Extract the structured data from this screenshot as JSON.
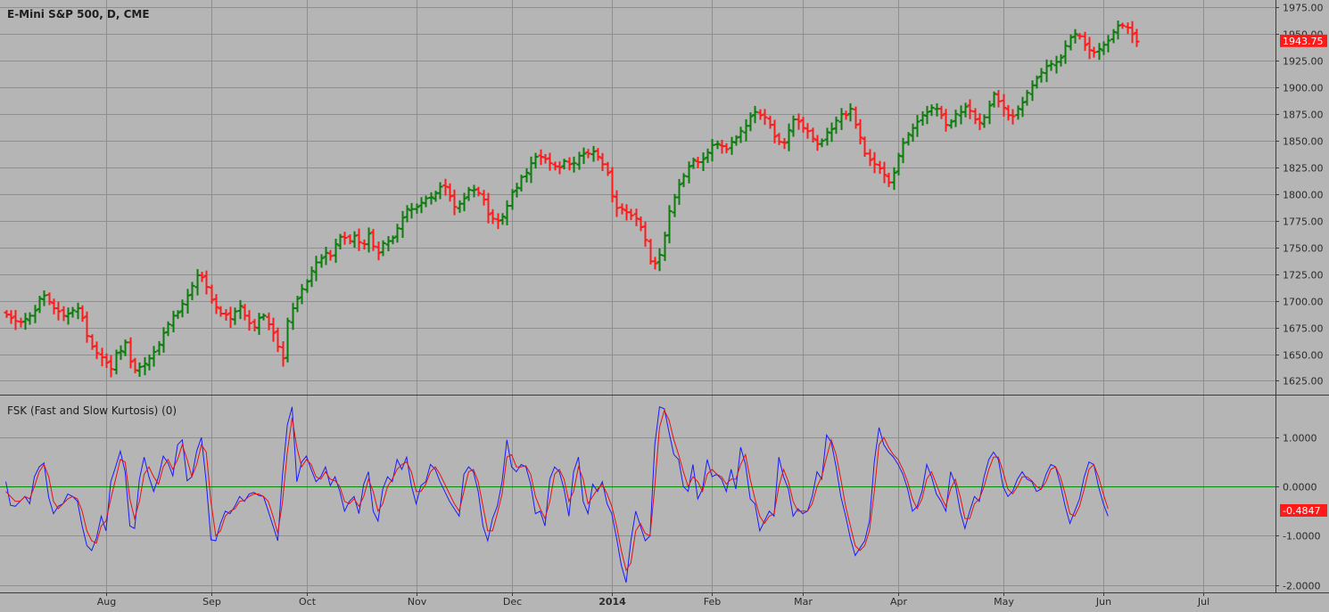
{
  "colors": {
    "background": "#b5b5b5",
    "grid": "#8f8f8f",
    "up_bar": "#0a7d0a",
    "down_bar": "#ff1a1a",
    "fast_line": "#1a1aff",
    "slow_line": "#e81010",
    "zero_line": "#0a8a0a",
    "badge": "#ff1a1a"
  },
  "price_panel": {
    "title": "E-Mini S&P 500, D, CME",
    "last_price_label": "1943.75"
  },
  "indicator_panel": {
    "title": "FSK (Fast and Slow Kurtosis) (0)",
    "last_value_label": "-0.4847"
  },
  "chart_data": [
    {
      "type": "ohlc",
      "title": "E-Mini S&P 500, D, CME",
      "ylim": [
        1612,
        1982
      ],
      "y_ticks": [
        "1625.00",
        "1650.00",
        "1675.00",
        "1700.00",
        "1725.00",
        "1750.00",
        "1775.00",
        "1800.00",
        "1825.00",
        "1850.00",
        "1875.00",
        "1900.00",
        "1925.00",
        "1950.00",
        "1975.00"
      ],
      "x_ticks": [
        {
          "label": "Aug",
          "bold": false
        },
        {
          "label": "Sep",
          "bold": false
        },
        {
          "label": "Oct",
          "bold": false
        },
        {
          "label": "Nov",
          "bold": false
        },
        {
          "label": "Dec",
          "bold": false
        },
        {
          "label": "2014",
          "bold": true
        },
        {
          "label": "Feb",
          "bold": false
        },
        {
          "label": "Mar",
          "bold": false
        },
        {
          "label": "Apr",
          "bold": false
        },
        {
          "label": "May",
          "bold": false
        },
        {
          "label": "Jun",
          "bold": false
        },
        {
          "label": "Jul",
          "bold": false
        }
      ],
      "month_start_bars": [
        21,
        43,
        63,
        86,
        106,
        127,
        148,
        167,
        187,
        209,
        230,
        251
      ],
      "closes": [
        1687,
        1684,
        1681,
        1680,
        1683,
        1686,
        1691,
        1702,
        1705,
        1699,
        1693,
        1690,
        1686,
        1688,
        1691,
        1693,
        1684,
        1667,
        1657,
        1651,
        1647,
        1642,
        1636,
        1651,
        1653,
        1661,
        1643,
        1635,
        1638,
        1641,
        1646,
        1652,
        1659,
        1670,
        1678,
        1686,
        1689,
        1697,
        1705,
        1714,
        1724,
        1722,
        1713,
        1701,
        1694,
        1688,
        1687,
        1683,
        1690,
        1695,
        1686,
        1679,
        1675,
        1684,
        1686,
        1678,
        1670,
        1657,
        1646,
        1681,
        1693,
        1702,
        1711,
        1718,
        1728,
        1736,
        1740,
        1745,
        1742,
        1753,
        1760,
        1759,
        1756,
        1761,
        1755,
        1753,
        1763,
        1751,
        1745,
        1754,
        1756,
        1759,
        1768,
        1778,
        1786,
        1786,
        1788,
        1792,
        1796,
        1797,
        1801,
        1807,
        1807,
        1798,
        1788,
        1791,
        1796,
        1804,
        1804,
        1801,
        1795,
        1781,
        1777,
        1775,
        1779,
        1789,
        1802,
        1806,
        1816,
        1820,
        1829,
        1835,
        1835,
        1833,
        1829,
        1826,
        1825,
        1831,
        1828,
        1829,
        1836,
        1838,
        1838,
        1840,
        1835,
        1828,
        1820,
        1798,
        1787,
        1786,
        1783,
        1780,
        1777,
        1769,
        1757,
        1737,
        1735,
        1743,
        1761,
        1784,
        1797,
        1809,
        1817,
        1826,
        1832,
        1830,
        1833,
        1839,
        1846,
        1847,
        1845,
        1842,
        1849,
        1853,
        1859,
        1864,
        1873,
        1877,
        1874,
        1872,
        1865,
        1854,
        1849,
        1848,
        1860,
        1870,
        1868,
        1862,
        1859,
        1852,
        1847,
        1850,
        1858,
        1861,
        1869,
        1875,
        1874,
        1880,
        1865,
        1853,
        1838,
        1832,
        1828,
        1824,
        1818,
        1811,
        1820,
        1836,
        1848,
        1856,
        1862,
        1868,
        1874,
        1877,
        1881,
        1880,
        1874,
        1865,
        1868,
        1875,
        1877,
        1882,
        1878,
        1870,
        1867,
        1872,
        1883,
        1894,
        1887,
        1881,
        1874,
        1873,
        1880,
        1886,
        1895,
        1902,
        1909,
        1914,
        1920,
        1922,
        1924,
        1928,
        1939,
        1947,
        1950,
        1948,
        1940,
        1935,
        1933,
        1936,
        1940,
        1944,
        1952,
        1958,
        1958,
        1956,
        1950,
        1943
      ],
      "fast_series": [
        0.1,
        -0.38,
        -0.4,
        -0.3,
        -0.2,
        -0.35,
        0.2,
        0.4,
        0.48,
        -0.22,
        -0.55,
        -0.4,
        -0.35,
        -0.15,
        -0.2,
        -0.3,
        -0.8,
        -1.2,
        -1.3,
        -1.05,
        -0.6,
        -0.9,
        0.1,
        0.4,
        0.72,
        0.3,
        -0.8,
        -0.85,
        0.15,
        0.6,
        0.2,
        -0.1,
        0.2,
        0.62,
        0.48,
        0.22,
        0.85,
        0.95,
        0.12,
        0.2,
        0.72,
        1.0,
        0.1,
        -1.08,
        -1.1,
        -0.75,
        -0.5,
        -0.55,
        -0.4,
        -0.2,
        -0.3,
        -0.15,
        -0.12,
        -0.18,
        -0.2,
        -0.5,
        -0.8,
        -1.1,
        0.25,
        1.25,
        1.62,
        0.1,
        0.5,
        0.62,
        0.35,
        0.1,
        0.2,
        0.4,
        0.02,
        0.2,
        -0.1,
        -0.5,
        -0.3,
        -0.2,
        -0.55,
        0.05,
        0.3,
        -0.5,
        -0.7,
        -0.05,
        0.2,
        0.1,
        0.55,
        0.35,
        0.6,
        0.02,
        -0.35,
        0.02,
        0.1,
        0.45,
        0.35,
        0.1,
        -0.1,
        -0.3,
        -0.45,
        -0.6,
        0.25,
        0.4,
        0.3,
        -0.1,
        -0.8,
        -1.1,
        -0.65,
        -0.4,
        0.1,
        0.95,
        0.4,
        0.3,
        0.45,
        0.4,
        0.05,
        -0.55,
        -0.5,
        -0.8,
        0.15,
        0.4,
        0.3,
        -0.05,
        -0.6,
        0.3,
        0.6,
        -0.3,
        -0.55,
        0.05,
        -0.1,
        0.1,
        -0.35,
        -0.55,
        -1.05,
        -1.6,
        -1.95,
        -1.1,
        -0.5,
        -0.8,
        -1.1,
        -1.0,
        0.85,
        1.62,
        1.58,
        1.1,
        0.65,
        0.55,
        0.0,
        -0.1,
        0.45,
        -0.25,
        -0.05,
        0.55,
        0.2,
        0.25,
        0.15,
        -0.1,
        0.35,
        -0.05,
        0.8,
        0.45,
        -0.25,
        -0.35,
        -0.9,
        -0.7,
        -0.5,
        -0.6,
        0.6,
        0.2,
        -0.05,
        -0.6,
        -0.45,
        -0.55,
        -0.5,
        -0.2,
        0.3,
        0.15,
        1.05,
        0.9,
        0.4,
        -0.2,
        -0.6,
        -1.05,
        -1.4,
        -1.25,
        -1.1,
        -0.7,
        0.5,
        1.2,
        0.85,
        0.7,
        0.6,
        0.45,
        0.25,
        -0.05,
        -0.5,
        -0.4,
        -0.1,
        0.45,
        0.2,
        -0.15,
        -0.3,
        -0.5,
        0.3,
        0.05,
        -0.5,
        -0.85,
        -0.5,
        -0.2,
        -0.3,
        0.2,
        0.55,
        0.7,
        0.55,
        0.0,
        -0.2,
        -0.1,
        0.15,
        0.3,
        0.15,
        0.1,
        -0.1,
        -0.05,
        0.25,
        0.45,
        0.4,
        0.05,
        -0.4,
        -0.75,
        -0.5,
        -0.25,
        0.2,
        0.5,
        0.45,
        0.0,
        -0.35,
        -0.6
      ],
      "slow_series": [
        -0.1,
        -0.2,
        -0.3,
        -0.3,
        -0.2,
        -0.25,
        0.0,
        0.3,
        0.45,
        0.2,
        -0.3,
        -0.45,
        -0.35,
        -0.25,
        -0.2,
        -0.25,
        -0.5,
        -0.9,
        -1.1,
        -1.15,
        -0.8,
        -0.7,
        -0.25,
        0.15,
        0.55,
        0.5,
        -0.25,
        -0.65,
        -0.3,
        0.25,
        0.4,
        0.2,
        0.05,
        0.4,
        0.55,
        0.35,
        0.55,
        0.85,
        0.55,
        0.2,
        0.45,
        0.85,
        0.7,
        -0.3,
        -1.0,
        -0.9,
        -0.6,
        -0.5,
        -0.45,
        -0.3,
        -0.28,
        -0.2,
        -0.15,
        -0.15,
        -0.2,
        -0.3,
        -0.6,
        -0.95,
        -0.3,
        0.7,
        1.4,
        0.8,
        0.4,
        0.55,
        0.45,
        0.2,
        0.15,
        0.3,
        0.15,
        0.12,
        0.0,
        -0.3,
        -0.35,
        -0.25,
        -0.4,
        -0.2,
        0.15,
        -0.1,
        -0.5,
        -0.35,
        0.0,
        0.15,
        0.35,
        0.45,
        0.5,
        0.3,
        -0.1,
        -0.1,
        0.05,
        0.3,
        0.4,
        0.25,
        0.05,
        -0.15,
        -0.35,
        -0.5,
        -0.1,
        0.3,
        0.35,
        0.1,
        -0.4,
        -0.9,
        -0.9,
        -0.55,
        -0.15,
        0.6,
        0.65,
        0.4,
        0.4,
        0.42,
        0.25,
        -0.2,
        -0.45,
        -0.65,
        -0.3,
        0.25,
        0.35,
        0.15,
        -0.3,
        -0.1,
        0.4,
        0.15,
        -0.35,
        -0.2,
        -0.05,
        0.05,
        -0.15,
        -0.4,
        -0.8,
        -1.3,
        -1.7,
        -1.55,
        -0.9,
        -0.75,
        -0.95,
        -1.0,
        0.0,
        1.2,
        1.55,
        1.35,
        0.95,
        0.65,
        0.3,
        0.0,
        0.2,
        0.1,
        -0.1,
        0.25,
        0.35,
        0.25,
        0.2,
        0.05,
        0.15,
        0.15,
        0.45,
        0.65,
        0.15,
        -0.25,
        -0.6,
        -0.75,
        -0.6,
        -0.55,
        0.0,
        0.35,
        0.1,
        -0.3,
        -0.5,
        -0.5,
        -0.5,
        -0.35,
        0.0,
        0.2,
        0.6,
        0.95,
        0.65,
        0.15,
        -0.4,
        -0.8,
        -1.2,
        -1.3,
        -1.2,
        -0.9,
        -0.1,
        0.85,
        1.0,
        0.8,
        0.65,
        0.55,
        0.35,
        0.1,
        -0.25,
        -0.45,
        -0.25,
        0.15,
        0.3,
        0.05,
        -0.2,
        -0.4,
        -0.05,
        0.15,
        -0.2,
        -0.65,
        -0.65,
        -0.35,
        -0.25,
        0.0,
        0.35,
        0.6,
        0.6,
        0.3,
        -0.05,
        -0.15,
        0.0,
        0.2,
        0.2,
        0.12,
        0.0,
        -0.05,
        0.1,
        0.35,
        0.4,
        0.2,
        -0.15,
        -0.55,
        -0.6,
        -0.4,
        -0.05,
        0.35,
        0.45,
        0.2,
        -0.15,
        -0.45
      ],
      "ind_ylim": [
        -2.15,
        1.85
      ],
      "ind_y_ticks": [
        "1.0000",
        "0.0000",
        "-1.0000",
        "-2.0000"
      ]
    }
  ]
}
